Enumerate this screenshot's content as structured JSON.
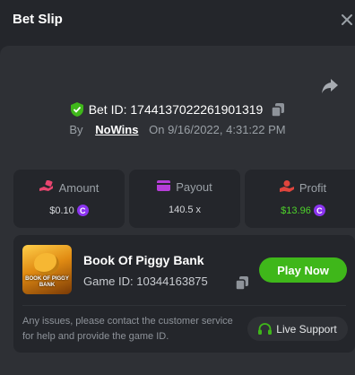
{
  "header": {
    "title": "Bet Slip",
    "close_icon": "close-icon"
  },
  "bet": {
    "id_label": "Bet ID: 1744137022261901319",
    "by_label": "By",
    "user": "NoWins",
    "on_label": "On",
    "datetime": "9/16/2022, 4:31:22 PM"
  },
  "stats": {
    "amount": {
      "label": "Amount",
      "value": "$0.10",
      "icon": "coins-hand-icon"
    },
    "payout": {
      "label": "Payout",
      "value": "140.5 x",
      "icon": "wallet-icon"
    },
    "profit": {
      "label": "Profit",
      "value": "$13.96",
      "icon": "money-hand-icon"
    },
    "coin_glyph": "C"
  },
  "game": {
    "name": "Book Of Piggy Bank",
    "id_label": "Game ID: 10344163875",
    "thumb_text": "BOOK OF PIGGY BANK",
    "play_label": "Play Now"
  },
  "support": {
    "notice": "Any issues, please contact the customer service for help and provide the game ID.",
    "button_label": "Live Support"
  },
  "colors": {
    "accent_green": "#3fb71a",
    "profit_green": "#4dd22a",
    "coin_purple": "#8b34f0",
    "amount_pink": "#e8456f",
    "payout_purple": "#b63ed8",
    "profit_red": "#e0453d"
  }
}
